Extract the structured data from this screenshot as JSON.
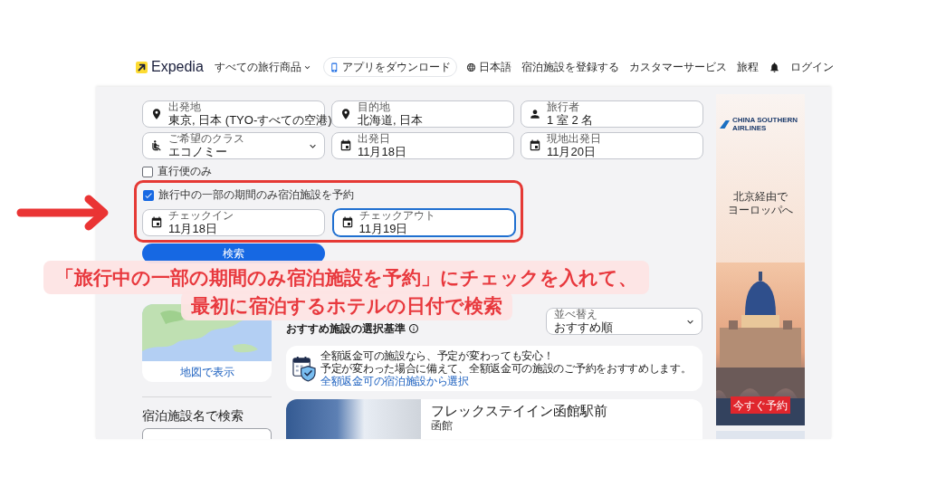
{
  "nav": {
    "logo": "Expedia",
    "menu": "すべての旅行商品",
    "app_button": "アプリをダウンロード",
    "language": "日本語",
    "links": [
      "宿泊施設を登録する",
      "カスタマーサービス",
      "旅程"
    ],
    "login": "ログイン"
  },
  "search_form": {
    "fields": [
      {
        "kind": "place",
        "label": "出発地",
        "value": "東京, 日本 (TYO-すべての空港)"
      },
      {
        "kind": "place",
        "label": "目的地",
        "value": "北海道, 日本"
      },
      {
        "kind": "person",
        "label": "旅行者",
        "value": "1 室 2 名"
      },
      {
        "kind": "select",
        "label": "ご希望のクラス",
        "value": "エコノミー"
      },
      {
        "kind": "date",
        "label": "出発日",
        "value": "11月18日"
      },
      {
        "kind": "date",
        "label": "現地出発日",
        "value": "11月20日"
      }
    ],
    "direct_only": {
      "label": "直行便のみ",
      "checked": false
    },
    "partial_stay": {
      "label": "旅行中の一部の期間のみ宿泊施設を予約",
      "checked": true,
      "fields": [
        {
          "label": "チェックイン",
          "value": "11月18日",
          "focused": false
        },
        {
          "label": "チェックアウト",
          "value": "11月19日",
          "focused": true
        }
      ]
    },
    "search_button": "検索"
  },
  "annotation": {
    "lines": [
      "「旅行中の一部の期間のみ宿泊施設を予約」にチェックを入れて、",
      "最初に宿泊するホテルの日付で検索"
    ]
  },
  "sidebar": {
    "map_link": "地図で表示",
    "name_search_title": "宿泊施設名で検索"
  },
  "results": {
    "criteria": "おすすめ施設の選択基準",
    "sort": {
      "label": "並べ替え",
      "value": "おすすめ順"
    },
    "info_card": {
      "title": "全額返金可の施設なら、予定が変わっても安心！",
      "text": "予定が変わった場合に備えて、全額返金可の施設のご予約をおすすめします。",
      "link": "全額返金可の宿泊施設から選択"
    },
    "hotels": [
      {
        "name": "フレックステイイン函館駅前",
        "location": "函館"
      }
    ]
  },
  "ad": {
    "brand": "CHINA SOUTHERN AIRLINES",
    "headline": [
      "北京経由で",
      "ヨーロッパへ"
    ],
    "button": "今すぐ予約"
  }
}
